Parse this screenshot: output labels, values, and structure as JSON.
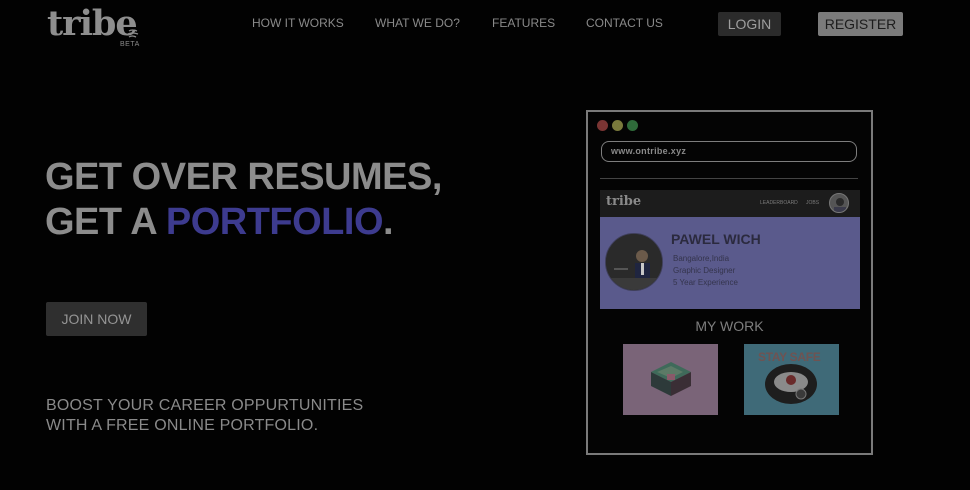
{
  "brand": {
    "name": "tribe",
    "badge": "BETA"
  },
  "nav": {
    "links": [
      "HOW IT WORKS",
      "WHAT WE DO?",
      "FEATURES",
      "CONTACT US"
    ],
    "login": "LOGIN",
    "register": "REGISTER"
  },
  "hero": {
    "line1": "GET OVER RESUMES,",
    "line2_prefix": "GET A ",
    "line2_accent": "PORTFOLIO",
    "line2_suffix": ".",
    "cta": "JOIN NOW",
    "tagline_1": "BOOST YOUR CAREER OPPURTUNITIES",
    "tagline_2": "WITH A FREE ONLINE PORTFOLIO."
  },
  "mockup": {
    "url": "www.ontribe.xyz",
    "mini_logo": "tribe",
    "mini_nav": [
      "LEADERBOARD",
      "JOBS"
    ],
    "profile": {
      "name": "PAWEL WICH",
      "location": "Bangalore,India",
      "role": "Graphic Designer",
      "experience": "5 Year Experience"
    },
    "section_title": "MY WORK",
    "work_2_text": "STAY SAFE"
  },
  "colors": {
    "background": "#020202",
    "accent": "#3d3b8f",
    "profile_card": "#5a5a8c",
    "window_dots": [
      "#7a3533",
      "#7a7a3c",
      "#2f6b3a"
    ]
  },
  "icons": [
    "wave-lines-icon",
    "window-close-dot-icon",
    "window-minimize-dot-icon",
    "window-maximize-dot-icon"
  ]
}
